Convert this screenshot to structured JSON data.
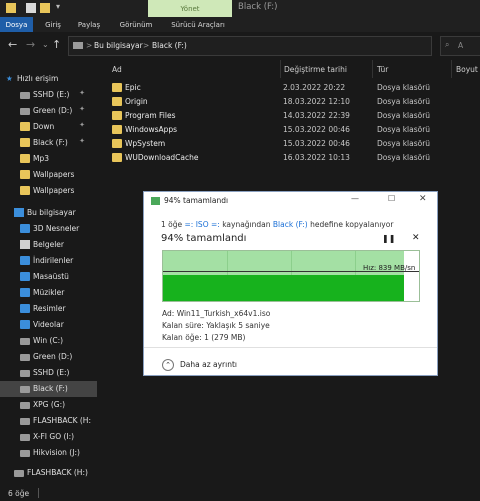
{
  "window": {
    "title": "Black (F:)",
    "contextual_tab": "Yönet"
  },
  "ribbon_tabs": [
    "Dosya",
    "Giriş",
    "Paylaş",
    "Görünüm",
    "Sürücü Araçları"
  ],
  "address": {
    "crumbs": [
      "Bu bilgisayar",
      "Black (F:)"
    ],
    "separator": ">"
  },
  "search": {
    "placeholder": "A"
  },
  "columns": {
    "name": "Ad",
    "date": "Değiştirme tarihi",
    "type": "Tür",
    "size": "Boyut"
  },
  "sidebar": {
    "quick_access": "Hızlı erişim",
    "quick_items": [
      {
        "label": "SSHD (E:)",
        "pinned": true
      },
      {
        "label": "Green (D:)",
        "pinned": true
      },
      {
        "label": "Down",
        "pinned": true
      },
      {
        "label": "Black (F:)",
        "pinned": true
      },
      {
        "label": "Mp3",
        "pinned": false
      },
      {
        "label": "Wallpapers",
        "pinned": false
      },
      {
        "label": "Wallpapers",
        "pinned": false
      }
    ],
    "this_pc": "Bu bilgisayar",
    "pc_items": [
      "3D Nesneler",
      "Belgeler",
      "İndirilenler",
      "Masaüstü",
      "Müzikler",
      "Resimler",
      "Videolar",
      "Win (C:)",
      "Green (D:)",
      "SSHD (E:)",
      "Black (F:)",
      "XPG (G:)",
      "FLASHBACK (H:",
      "X-FI GO (I:)",
      "Hikvision (J:)"
    ],
    "bottom_item": "FLASHBACK (H:)",
    "pin_glyph": "✦"
  },
  "files": [
    {
      "name": "Epic",
      "date": "2.03.2022 20:22",
      "type": "Dosya klasörü"
    },
    {
      "name": "Origin",
      "date": "18.03.2022 12:10",
      "type": "Dosya klasörü"
    },
    {
      "name": "Program Files",
      "date": "14.03.2022 22:39",
      "type": "Dosya klasörü"
    },
    {
      "name": "WindowsApps",
      "date": "15.03.2022 00:46",
      "type": "Dosya klasörü"
    },
    {
      "name": "WpSystem",
      "date": "15.03.2022 00:46",
      "type": "Dosya klasörü"
    },
    {
      "name": "WUDownloadCache",
      "date": "16.03.2022 10:13",
      "type": "Dosya klasörü"
    }
  ],
  "status": {
    "count": "6 öğe"
  },
  "dialog": {
    "title": "94% tamamlandı",
    "line_prefix": "1 öğe",
    "line_from": "ISO",
    "line_mid": "kaynağından",
    "line_to": "Black (F:)",
    "line_suffix": "hedefine kopyalanıyor",
    "percent_text": "94% tamamlandı",
    "progress": 0.94,
    "speed_label": "Hız: 839 MB/sn",
    "name_label": "Ad:",
    "name_value": "Win11_Turkish_x64v1.iso",
    "time_label": "Kalan süre:",
    "time_value": "Yaklaşık 5 saniye",
    "items_label": "Kalan öğe:",
    "items_value": "1 (279 MB)",
    "details": "Daha az ayrıntı"
  }
}
